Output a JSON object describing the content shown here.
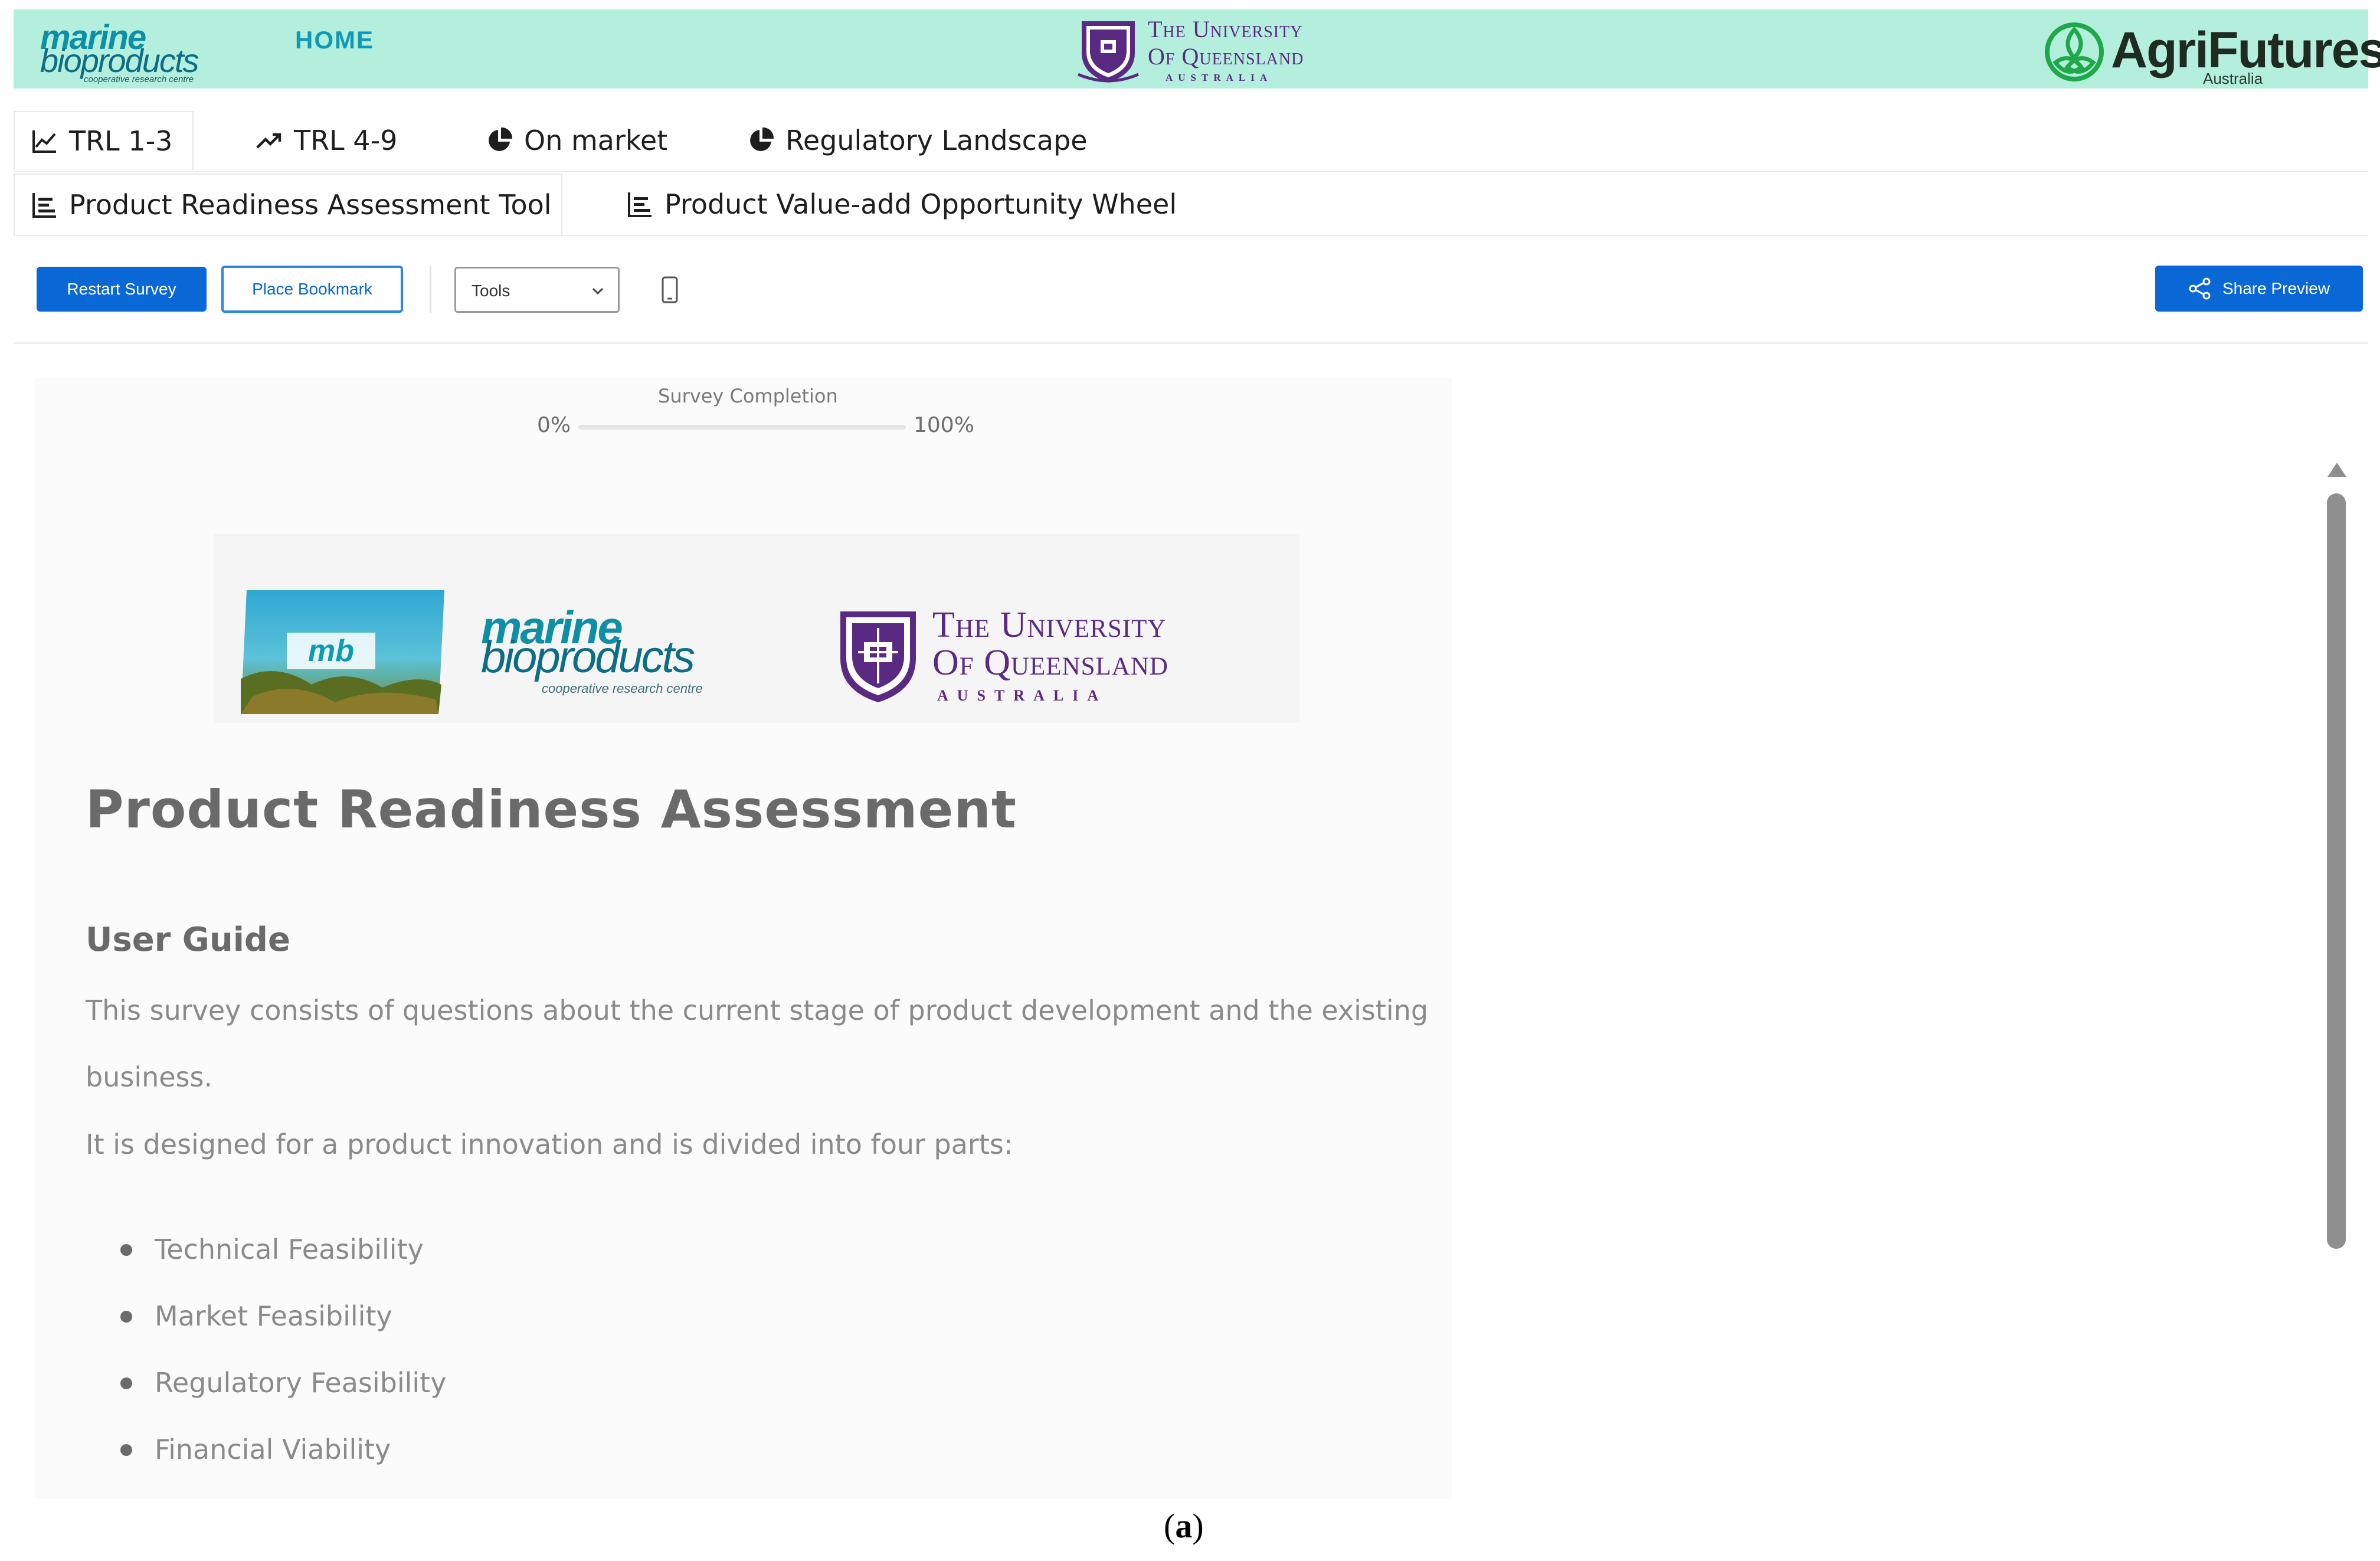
{
  "header": {
    "mb_logo": {
      "line1": "marine",
      "line2": "bioproducts",
      "line3": "cooperative research centre"
    },
    "home_label": "HOME",
    "uq_logo": {
      "line1": "The University",
      "line2": "Of Queensland",
      "line3": "AUSTRALIA"
    },
    "agri_logo": {
      "name": "AgriFutures",
      "sub": "Australia"
    },
    "bg_color": "#b3efdc"
  },
  "tabs_row1": [
    {
      "label": "TRL 1-3",
      "icon": "line-chart-icon",
      "active": true
    },
    {
      "label": "TRL 4-9",
      "icon": "trending-up-icon",
      "active": false
    },
    {
      "label": "On market",
      "icon": "pie-chart-icon",
      "active": false
    },
    {
      "label": "Regulatory Landscape",
      "icon": "pie-chart-icon",
      "active": false
    }
  ],
  "tabs_row2": [
    {
      "label": "Product Readiness Assessment Tool",
      "icon": "bar-chart-icon",
      "active": true
    },
    {
      "label": "Product Value-add Opportunity Wheel",
      "icon": "bar-chart-icon",
      "active": false
    }
  ],
  "toolbar": {
    "restart_label": "Restart Survey",
    "bookmark_label": "Place Bookmark",
    "tools_value": "Tools",
    "device_icon": "mobile-device-icon",
    "share_label": "Share Preview",
    "share_icon": "share-icon",
    "accent_color": "#0a67d6"
  },
  "survey": {
    "progress_label": "Survey Completion",
    "progress_min": "0%",
    "progress_max": "100%",
    "progress_value": 0,
    "logos": {
      "mb": {
        "badge": "mb",
        "line1": "marine",
        "line2": "bioproducts",
        "line3": "cooperative research centre"
      },
      "uq": {
        "line1": "The University",
        "line2": "Of Queensland",
        "line3": "AUSTRALIA"
      }
    },
    "title": "Product Readiness Assessment",
    "guide_title": "User Guide",
    "paragraph1_line1": "This survey consists of questions about the current stage of product development and the existing",
    "paragraph1_line2": "business.",
    "paragraph2": "It is designed for a product innovation and is divided into four parts:",
    "parts": [
      "Technical Feasibility",
      "Market Feasibility",
      "Regulatory Feasibility",
      "Financial Viability"
    ]
  },
  "caption": {
    "open": "(",
    "letter": "a",
    "close": ")"
  }
}
